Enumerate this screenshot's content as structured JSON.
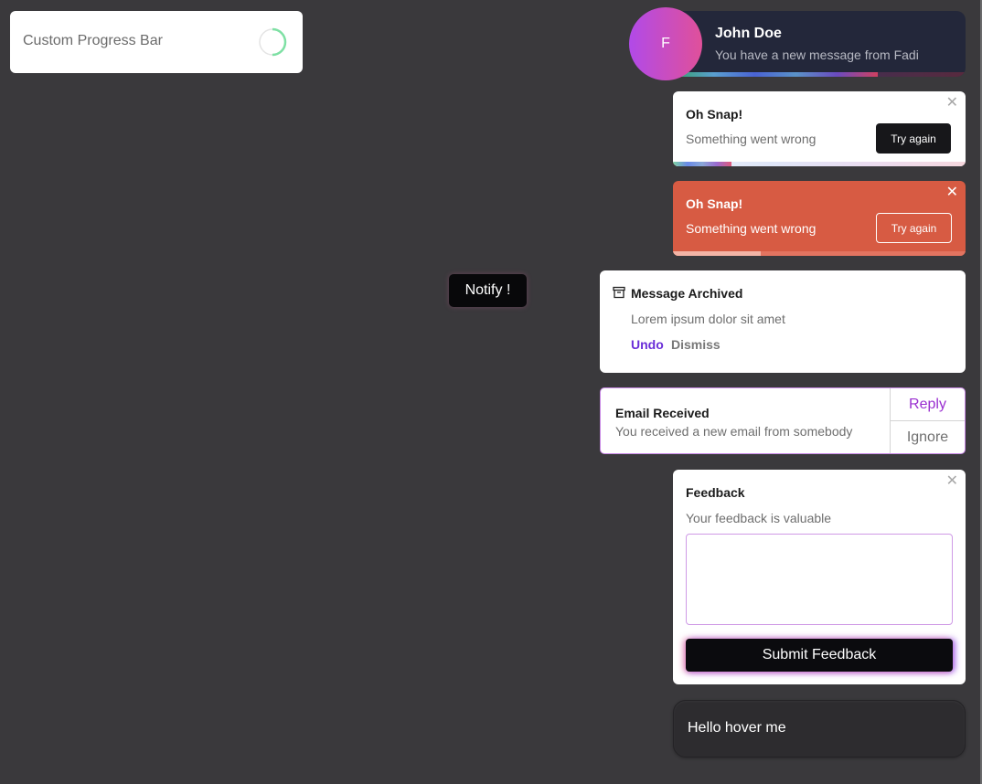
{
  "custom_progress": {
    "label": "Custom Progress Bar",
    "progress_percent": 50,
    "color": "#7ee0a4"
  },
  "notify_button": {
    "label": "Notify !"
  },
  "message_toast": {
    "avatar_initial": "F",
    "title": "John Doe",
    "message": "You have a new message from Fadi",
    "progress_percent": 70
  },
  "error_toast_light": {
    "title": "Oh Snap!",
    "message": "Something went wrong",
    "action_label": "Try again",
    "close_glyph": "✕",
    "progress_percent": 20
  },
  "error_toast_red": {
    "title": "Oh Snap!",
    "message": "Something went wrong",
    "action_label": "Try again",
    "close_glyph": "✕",
    "progress_percent": 30,
    "color": "#d75b43"
  },
  "archived_toast": {
    "icon": "archive-icon",
    "title": "Message Archived",
    "message": "Lorem ipsum dolor sit amet",
    "undo_label": "Undo",
    "dismiss_label": "Dismiss"
  },
  "email_toast": {
    "title": "Email Received",
    "message": "You received a new email from somebody",
    "reply_label": "Reply",
    "ignore_label": "Ignore"
  },
  "feedback_toast": {
    "title": "Feedback",
    "message": "Your feedback is valuable",
    "input_value": "",
    "submit_label": "Submit Feedback",
    "close_glyph": "✕"
  },
  "hover_card": {
    "label": "Hello hover me"
  }
}
